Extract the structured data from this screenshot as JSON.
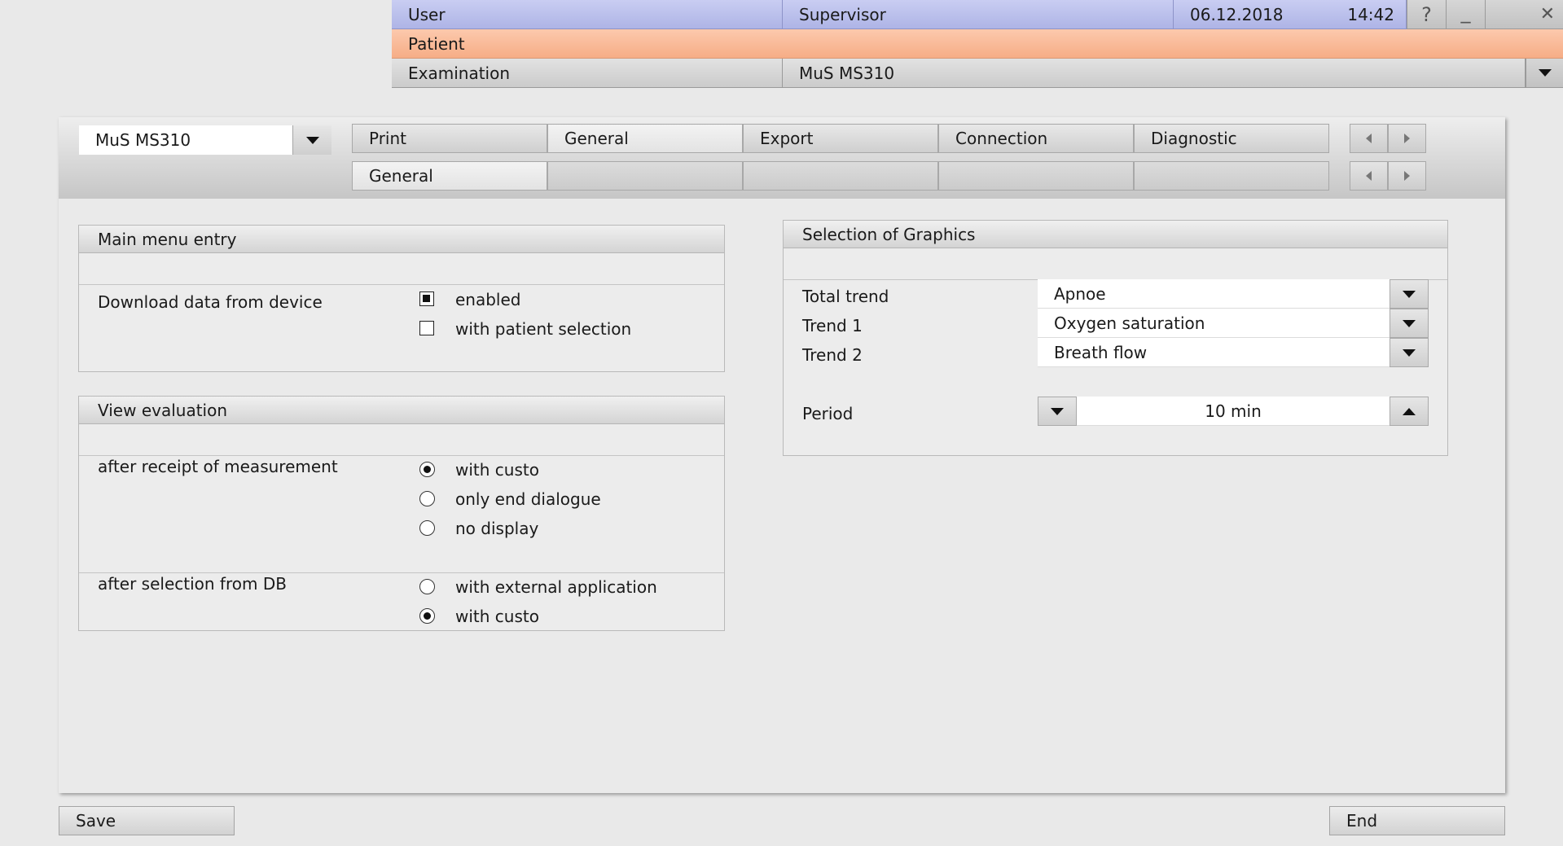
{
  "header": {
    "user_label": "User",
    "user_value": "Supervisor",
    "date": "06.12.2018",
    "time": "14:42",
    "help_label": "?",
    "minimize_label": "_",
    "close_label": "✕",
    "patient_label": "Patient",
    "patient_value": "",
    "examination_label": "Examination",
    "examination_value": "MuS MS310"
  },
  "device_select": {
    "value": "MuS MS310"
  },
  "tabs": [
    {
      "label": "Print"
    },
    {
      "label": "General"
    },
    {
      "label": "Export"
    },
    {
      "label": "Connection"
    },
    {
      "label": "Diagnostic"
    }
  ],
  "subtabs": [
    {
      "label": "General"
    },
    {
      "label": ""
    },
    {
      "label": ""
    },
    {
      "label": ""
    },
    {
      "label": ""
    }
  ],
  "main_menu_entry": {
    "title": "Main menu entry",
    "download_label": "Download data from device",
    "options": [
      {
        "label": "enabled",
        "checked": true
      },
      {
        "label": "with patient selection",
        "checked": false
      }
    ]
  },
  "view_evaluation": {
    "title": "View evaluation",
    "after_receipt_label": "after receipt of measurement",
    "after_receipt_options": [
      {
        "label": "with custo",
        "selected": true
      },
      {
        "label": "only end dialogue",
        "selected": false
      },
      {
        "label": "no display",
        "selected": false
      }
    ],
    "after_selection_label": "after selection from DB",
    "after_selection_options": [
      {
        "label": "with external application",
        "selected": false
      },
      {
        "label": "with custo",
        "selected": true
      }
    ]
  },
  "graphics": {
    "title": "Selection of Graphics",
    "rows": [
      {
        "label": "Total trend",
        "value": "Apnoe"
      },
      {
        "label": "Trend 1",
        "value": "Oxygen saturation"
      },
      {
        "label": "Trend 2",
        "value": "Breath flow"
      }
    ],
    "period_label": "Period",
    "period_value": "10 min"
  },
  "footer": {
    "save_label": "Save",
    "end_label": "End"
  },
  "colors": {
    "user_bar": "#b8bdec",
    "patient_bar": "#f9b996",
    "panel": "#eaeaea"
  }
}
